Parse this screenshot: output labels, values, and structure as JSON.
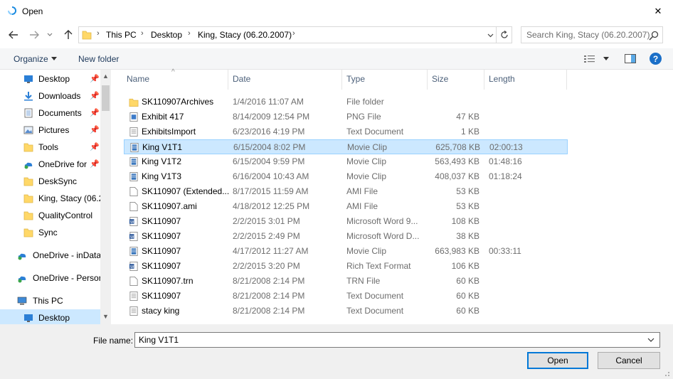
{
  "window": {
    "title": "Open",
    "close_glyph": "✕"
  },
  "nav": {
    "back_icon": "arrow-left-icon",
    "forward_icon": "arrow-right-icon",
    "recent_icon": "chevron-down-icon",
    "up_icon": "arrow-up-icon",
    "breadcrumbs": [
      "This PC",
      "Desktop",
      "King, Stacy (06.20.2007)"
    ],
    "search_placeholder": "Search King, Stacy (06.20.2007)"
  },
  "toolbar": {
    "organize_label": "Organize",
    "new_folder_label": "New folder",
    "help_label": "?"
  },
  "sidebar": {
    "items": [
      {
        "label": "Desktop",
        "icon": "desktop-icon",
        "pinned": true
      },
      {
        "label": "Downloads",
        "icon": "download-icon",
        "pinned": true
      },
      {
        "label": "Documents",
        "icon": "documents-icon",
        "pinned": true
      },
      {
        "label": "Pictures",
        "icon": "pictures-icon",
        "pinned": true
      },
      {
        "label": "Tools",
        "icon": "folder-icon",
        "pinned": true
      },
      {
        "label": "OneDrive for",
        "icon": "onedrive-icon",
        "pinned": true
      },
      {
        "label": "DeskSync",
        "icon": "folder-icon",
        "pinned": false
      },
      {
        "label": "King, Stacy (06.2",
        "icon": "folder-icon",
        "pinned": false
      },
      {
        "label": "QualityControl",
        "icon": "folder-icon",
        "pinned": false
      },
      {
        "label": "Sync",
        "icon": "folder-icon",
        "pinned": false
      },
      {
        "label": "OneDrive - inData",
        "icon": "onedrive-icon",
        "pinned": false
      },
      {
        "label": "OneDrive - Persor",
        "icon": "onedrive-icon",
        "pinned": false
      },
      {
        "label": "This PC",
        "icon": "computer-icon",
        "pinned": false
      },
      {
        "label": "Desktop",
        "icon": "desktop-icon",
        "pinned": false
      }
    ],
    "pin_glyph": "📌"
  },
  "columns": {
    "name": "Name",
    "date": "Date",
    "type": "Type",
    "size": "Size",
    "length": "Length"
  },
  "files": [
    {
      "name": "SK110907Archives",
      "date": "1/4/2016 11:07 AM",
      "type": "File folder",
      "size": "",
      "length": "",
      "icon": "folder-icon"
    },
    {
      "name": "Exhibit 417",
      "date": "8/14/2009 12:54 PM",
      "type": "PNG File",
      "size": "47 KB",
      "length": "",
      "icon": "image-file-icon"
    },
    {
      "name": "ExhibitsImport",
      "date": "6/23/2016 4:19 PM",
      "type": "Text Document",
      "size": "1 KB",
      "length": "",
      "icon": "text-file-icon"
    },
    {
      "name": "King V1T1",
      "date": "6/15/2004 8:02 PM",
      "type": "Movie Clip",
      "size": "625,708 KB",
      "length": "02:00:13",
      "icon": "video-file-icon"
    },
    {
      "name": "King V1T2",
      "date": "6/15/2004 9:59 PM",
      "type": "Movie Clip",
      "size": "563,493 KB",
      "length": "01:48:16",
      "icon": "video-file-icon"
    },
    {
      "name": "King V1T3",
      "date": "6/16/2004 10:43 AM",
      "type": "Movie Clip",
      "size": "408,037 KB",
      "length": "01:18:24",
      "icon": "video-file-icon"
    },
    {
      "name": "SK110907 (Extended...",
      "date": "8/17/2015 11:59 AM",
      "type": "AMI File",
      "size": "53 KB",
      "length": "",
      "icon": "blank-file-icon"
    },
    {
      "name": "SK110907.ami",
      "date": "4/18/2012 12:25 PM",
      "type": "AMI File",
      "size": "53 KB",
      "length": "",
      "icon": "blank-file-icon"
    },
    {
      "name": "SK110907",
      "date": "2/2/2015 3:01 PM",
      "type": "Microsoft Word 9...",
      "size": "108 KB",
      "length": "",
      "icon": "word-file-icon"
    },
    {
      "name": "SK110907",
      "date": "2/2/2015 2:49 PM",
      "type": "Microsoft Word D...",
      "size": "38 KB",
      "length": "",
      "icon": "word-file-icon"
    },
    {
      "name": "SK110907",
      "date": "4/17/2012 11:27 AM",
      "type": "Movie Clip",
      "size": "663,983 KB",
      "length": "00:33:11",
      "icon": "video-file-icon"
    },
    {
      "name": "SK110907",
      "date": "2/2/2015 3:20 PM",
      "type": "Rich Text Format",
      "size": "106 KB",
      "length": "",
      "icon": "word-file-icon"
    },
    {
      "name": "SK110907.trn",
      "date": "8/21/2008 2:14 PM",
      "type": "TRN File",
      "size": "60 KB",
      "length": "",
      "icon": "blank-file-icon"
    },
    {
      "name": "SK110907",
      "date": "8/21/2008 2:14 PM",
      "type": "Text Document",
      "size": "60 KB",
      "length": "",
      "icon": "text-file-icon"
    },
    {
      "name": "stacy king",
      "date": "8/21/2008 2:14 PM",
      "type": "Text Document",
      "size": "60 KB",
      "length": "",
      "icon": "text-file-icon"
    }
  ],
  "selected_file_index": 3,
  "bottom": {
    "file_name_label": "File name:",
    "file_name_value": "King V1T1",
    "open_label": "Open",
    "cancel_label": "Cancel"
  },
  "colors": {
    "selection_bg": "#cce8ff",
    "selection_border": "#99d1ff",
    "accent": "#0078d7",
    "folder": "#ffd868"
  }
}
